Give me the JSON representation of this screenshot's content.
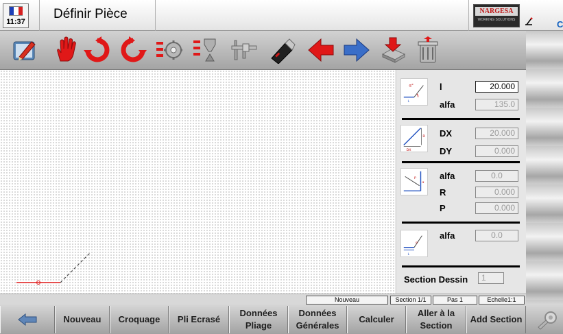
{
  "header": {
    "clock": "11:37",
    "title": "Définir Pièce",
    "logo_brand": "NARGESA",
    "logo_tagline": "WORKING SOLUTIONS",
    "status_letter": "C"
  },
  "toolbar": {
    "tools": [
      "edit-pencil-icon",
      "stop-hand-icon",
      "rotate-left-icon",
      "rotate-right-icon",
      "machine-list-icon",
      "tool-list-icon",
      "caliper-icon",
      "usb-drive-icon",
      "arrow-left-icon",
      "arrow-right-icon",
      "save-drive-icon",
      "trash-can-icon"
    ],
    "colors": {
      "red": "#e01818",
      "blue": "#3a6ec8",
      "gray": "#8a8a8a"
    }
  },
  "panel": {
    "group1": {
      "l_label": "l",
      "l_value": "20.000",
      "alfa_label": "alfa",
      "alfa_value": "135.0"
    },
    "group2": {
      "dx_label": "DX",
      "dx_value": "20.000",
      "dy_label": "DY",
      "dy_value": "0.000"
    },
    "group3": {
      "alfa_label": "alfa",
      "alfa_value": "0.0",
      "r_label": "R",
      "r_value": "0.000",
      "p_label": "P",
      "p_value": "0.000"
    },
    "group4": {
      "alfa_label": "alfa",
      "alfa_value": "0.0"
    },
    "section_label": "Section Dessin",
    "section_value": "1"
  },
  "status": {
    "mode": "Nouveau",
    "section": "Section 1/1",
    "step": "Pas 1",
    "scale": "Echelle1:1"
  },
  "bottom": {
    "nouveau": "Nouveau",
    "croquage": "Croquage",
    "pli_ecrase": "Pli Ecrasé",
    "donnees_pliage": "Données\nPliage",
    "donnees_generales": "Données\nGénérales",
    "calculer": "Calculer",
    "aller_section": "Aller à la\nSection",
    "add_section": "Add Section"
  }
}
